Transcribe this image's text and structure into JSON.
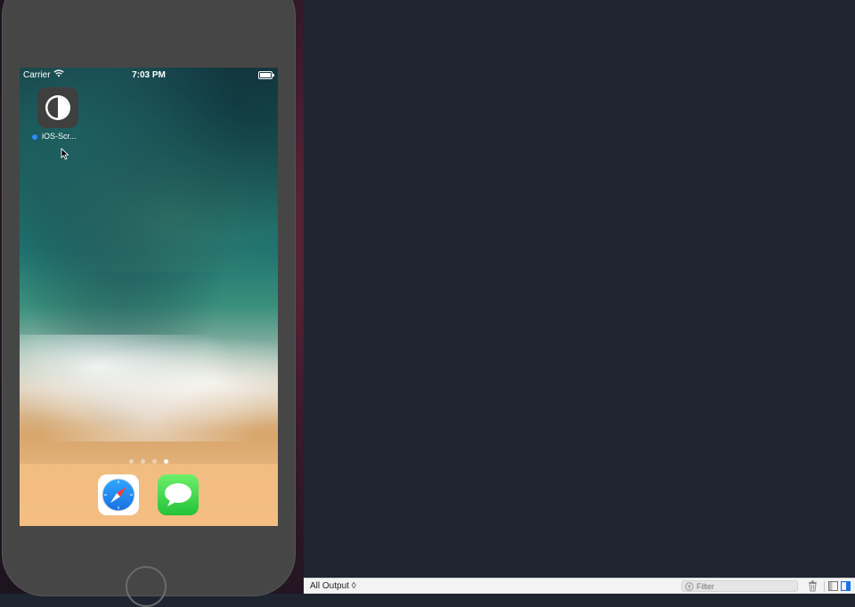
{
  "status_bar": {
    "carrier": "Carrier",
    "time": "7:03 PM"
  },
  "home_screen": {
    "app_label": "iOS-Scr...",
    "page_count": 4,
    "active_page": 4,
    "dock_apps": [
      "safari-icon",
      "messages-icon"
    ]
  },
  "console": {
    "output_selector": "All Output ◊",
    "filter_placeholder": "Filter"
  },
  "colors": {
    "console_bg": "#1f2430",
    "device_body": "#464646",
    "accent_blue": "#2d8cff"
  }
}
